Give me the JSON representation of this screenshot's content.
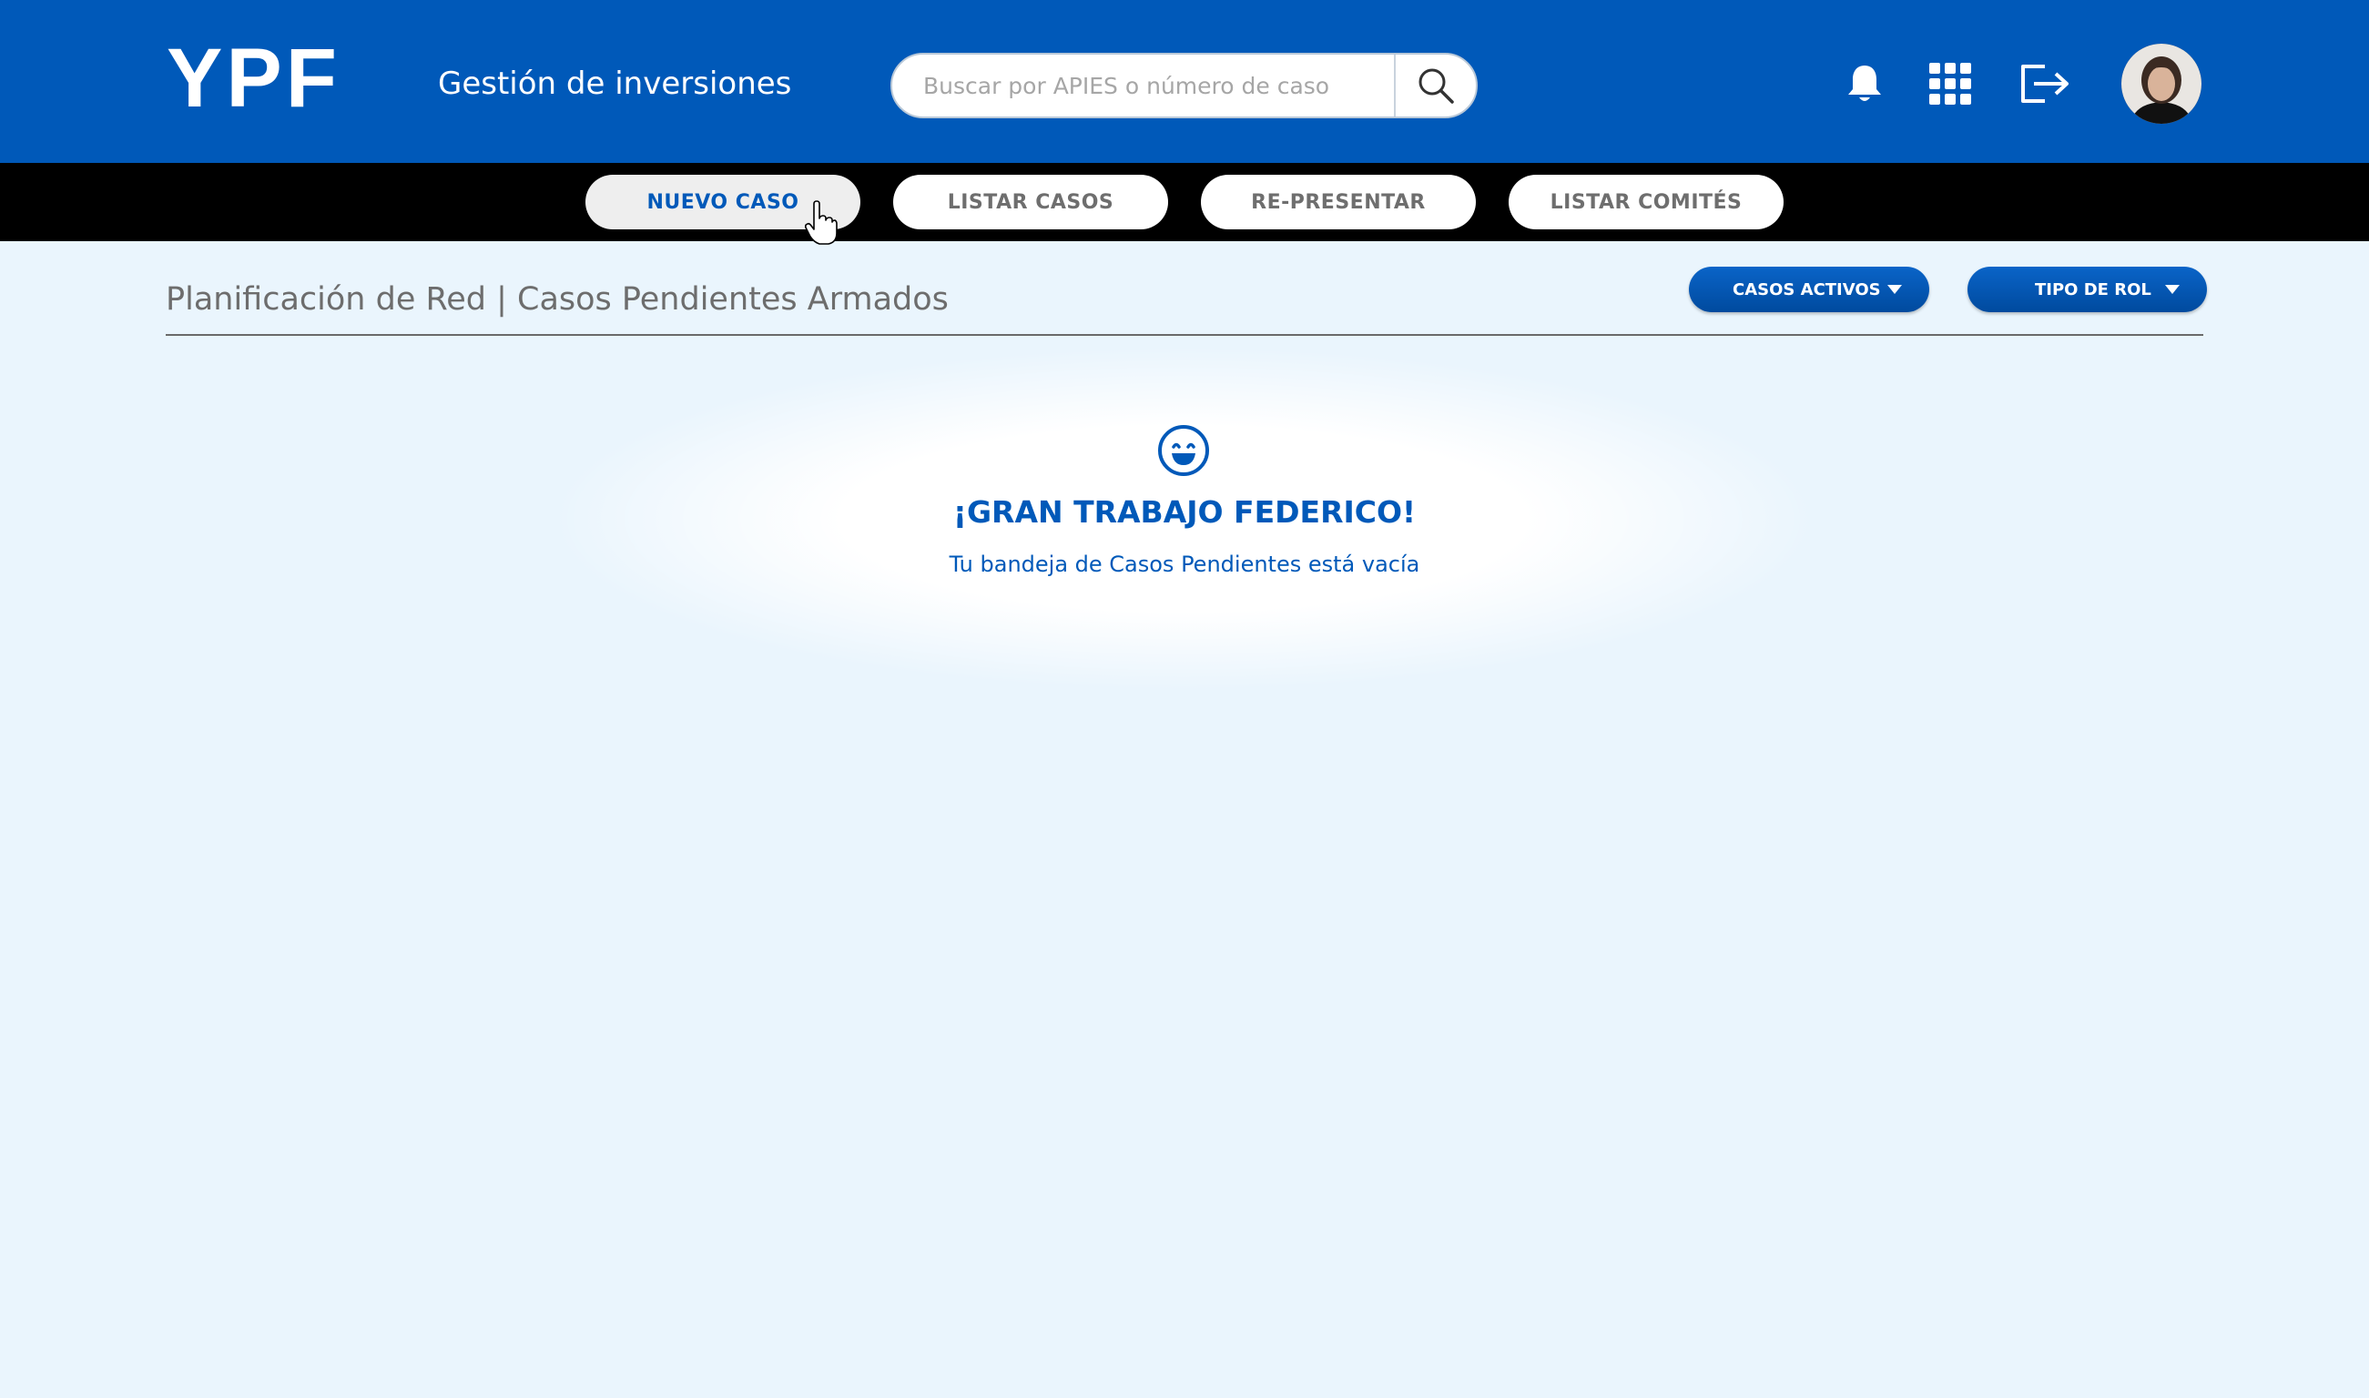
{
  "header": {
    "logo": "YPF",
    "app_title": "Gestión de inversiones",
    "search_placeholder": "Buscar por APIES o número de caso",
    "icons": [
      "search-icon",
      "bell-icon",
      "apps-grid-icon",
      "logout-icon",
      "avatar"
    ]
  },
  "nav": {
    "items": [
      {
        "label": "NUEVO CASO",
        "active": true
      },
      {
        "label": "LISTAR CASOS",
        "active": false
      },
      {
        "label": "RE-PRESENTAR",
        "active": false
      },
      {
        "label": "LISTAR COMITÉS",
        "active": false
      }
    ]
  },
  "section": {
    "title": "Planificación de Red | Casos Pendientes Armados",
    "dropdowns": [
      {
        "label": "CASOS ACTIVOS"
      },
      {
        "label": "TIPO DE ROL"
      }
    ]
  },
  "empty_state": {
    "icon": "smiley-icon",
    "title": "¡GRAN TRABAJO FEDERICO!",
    "subtitle": "Tu bandeja de Casos Pendientes está vacía"
  },
  "colors": {
    "primary": "#0059b9",
    "navbar": "#000000",
    "background": "#eaf5fd"
  }
}
